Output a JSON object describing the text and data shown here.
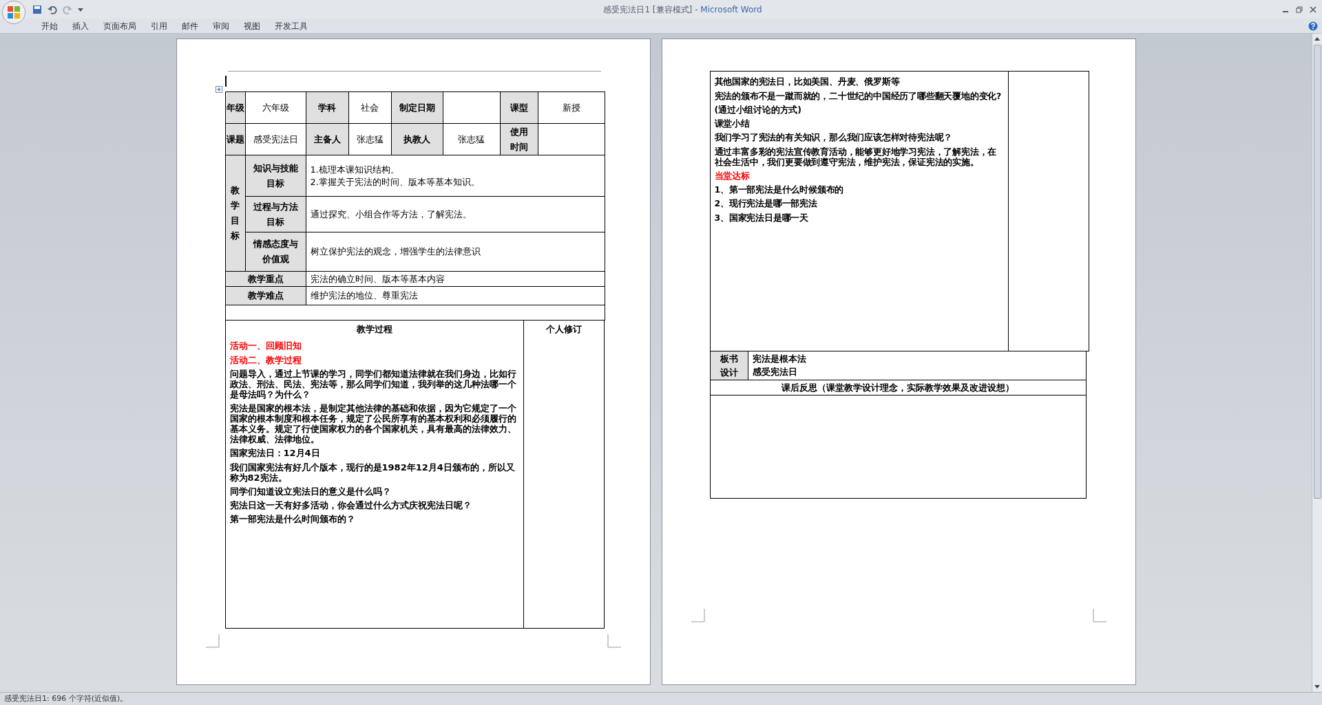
{
  "window": {
    "title_document": "感受宪法日1 [兼容模式]",
    "title_app": "- Microsoft Word"
  },
  "ribbon_tabs": [
    "开始",
    "插入",
    "页面布局",
    "引用",
    "邮件",
    "审阅",
    "视图",
    "开发工具"
  ],
  "lesson_table": {
    "row_1": [
      {
        "text": "年级",
        "header": true
      },
      {
        "text": "六年级",
        "header": false
      },
      {
        "text": "学科",
        "header": true
      },
      {
        "text": "社会",
        "header": false
      },
      {
        "text": "制定日期",
        "header": true
      },
      {
        "header": false
      },
      {
        "text": "课型",
        "header": true
      },
      {
        "text": "新授",
        "header": false
      }
    ],
    "row_2": [
      {
        "text": "课题",
        "header": true
      },
      {
        "text": "感受宪法日",
        "header": false
      },
      {
        "text": "主备人",
        "header": true
      },
      {
        "text": "张志猛",
        "header": false
      },
      {
        "text": "执教人",
        "header": true
      },
      {
        "text": "张志猛",
        "header": false
      },
      {
        "text": "使用时间",
        "header": true
      },
      {
        "header": false
      }
    ],
    "goals_label": "教学目标",
    "goals": [
      {
        "label": "知识与技能目标",
        "lines": [
          "1.梳理本课知识结构。",
          "2.掌握关于宪法的时间、版本等基本知识。"
        ]
      },
      {
        "label": "过程与方法目标",
        "lines": [
          "通过探究、小组合作等方法，了解宪法。"
        ]
      },
      {
        "label": "情感态度与价值观",
        "lines": [
          "树立保护宪法的观念，增强学生的法律意识"
        ]
      }
    ],
    "key_point": {
      "label": "教学重点",
      "text": "宪法的确立时间、版本等基本内容"
    },
    "difficulty": {
      "label": "教学难点",
      "text": "维护宪法的地位、尊重宪法"
    },
    "process": {
      "heading": "教学过程",
      "notes_heading": "个人修订",
      "paragraphs": [
        {
          "text": "活动一、回顾旧知",
          "color": "#ff0000"
        },
        {
          "text": "活动二、教学过程",
          "color": "#ff0000"
        },
        {
          "text": "问题导入，通过上节课的学习，同学们都知道法律就在我们身边，比如行政法、刑法、民法、宪法等，那么同学们知道，我列举的这几种法哪一个是母法吗？为什么？",
          "color": "#000000"
        },
        {
          "text": "宪法是国家的根本法，是制定其他法律的基础和依据，因为它规定了一个国家的根本制度和根本任务，规定了公民所享有的基本权利和必须履行的基本义务。规定了行使国家权力的各个国家机关，具有最高的法律效力、法律权威、法律地位。",
          "color": "#000000"
        },
        {
          "text": "国家宪法日：12月4日",
          "color": "#000000"
        },
        {
          "text": "我们国家宪法有好几个版本，现行的是1982年12月4日颁布的，所以又称为82宪法。",
          "color": "#000000"
        },
        {
          "text": "同学们知道设立宪法日的意义是什么吗？",
          "color": "#000000"
        },
        {
          "text": "宪法日这一天有好多活动，你会通过什么方式庆祝宪法日呢？",
          "color": "#000000"
        },
        {
          "text": "第一部宪法是什么时间颁布的？",
          "color": "#000000"
        }
      ]
    }
  },
  "page_2": {
    "paragraphs": [
      {
        "text": "其他国家的宪法日，比如美国、丹麦、俄罗斯等",
        "color": "#000000"
      },
      {
        "text": "宪法的颁布不是一蹴而就的，二十世纪的中国经历了哪些翻天覆地的变化?",
        "color": "#000000"
      },
      {
        "text": "(通过小组讨论的方式)",
        "color": "#000000"
      },
      {
        "text": "课堂小结",
        "color": "#000000"
      },
      {
        "text": "我们学习了宪法的有关知识，那么我们应该怎样对待宪法呢？",
        "color": "#000000"
      },
      {
        "text": "通过丰富多彩的宪法宣传教育活动，能够更好地学习宪法，了解宪法，在社会生活中，我们更要做到遵守宪法，维护宪法，保证宪法的实施。",
        "color": "#000000"
      },
      {
        "text": "当堂达标",
        "color": "#ff0000"
      },
      {
        "text": "1、第一部宪法是什么时候颁布的",
        "color": "#000000"
      },
      {
        "text": "2、现行宪法是哪一部宪法",
        "color": "#000000"
      },
      {
        "text": "3、国家宪法日是哪一天",
        "color": "#000000"
      }
    ],
    "board": {
      "label": "板书设计",
      "lines": [
        "宪法是根本法",
        "感受宪法日"
      ]
    },
    "reflection_heading": "课后反思（课堂教学设计理念，实际教学效果及改进设想）"
  },
  "status_bar": "感受宪法日1: 696 个字符(近似值)。"
}
